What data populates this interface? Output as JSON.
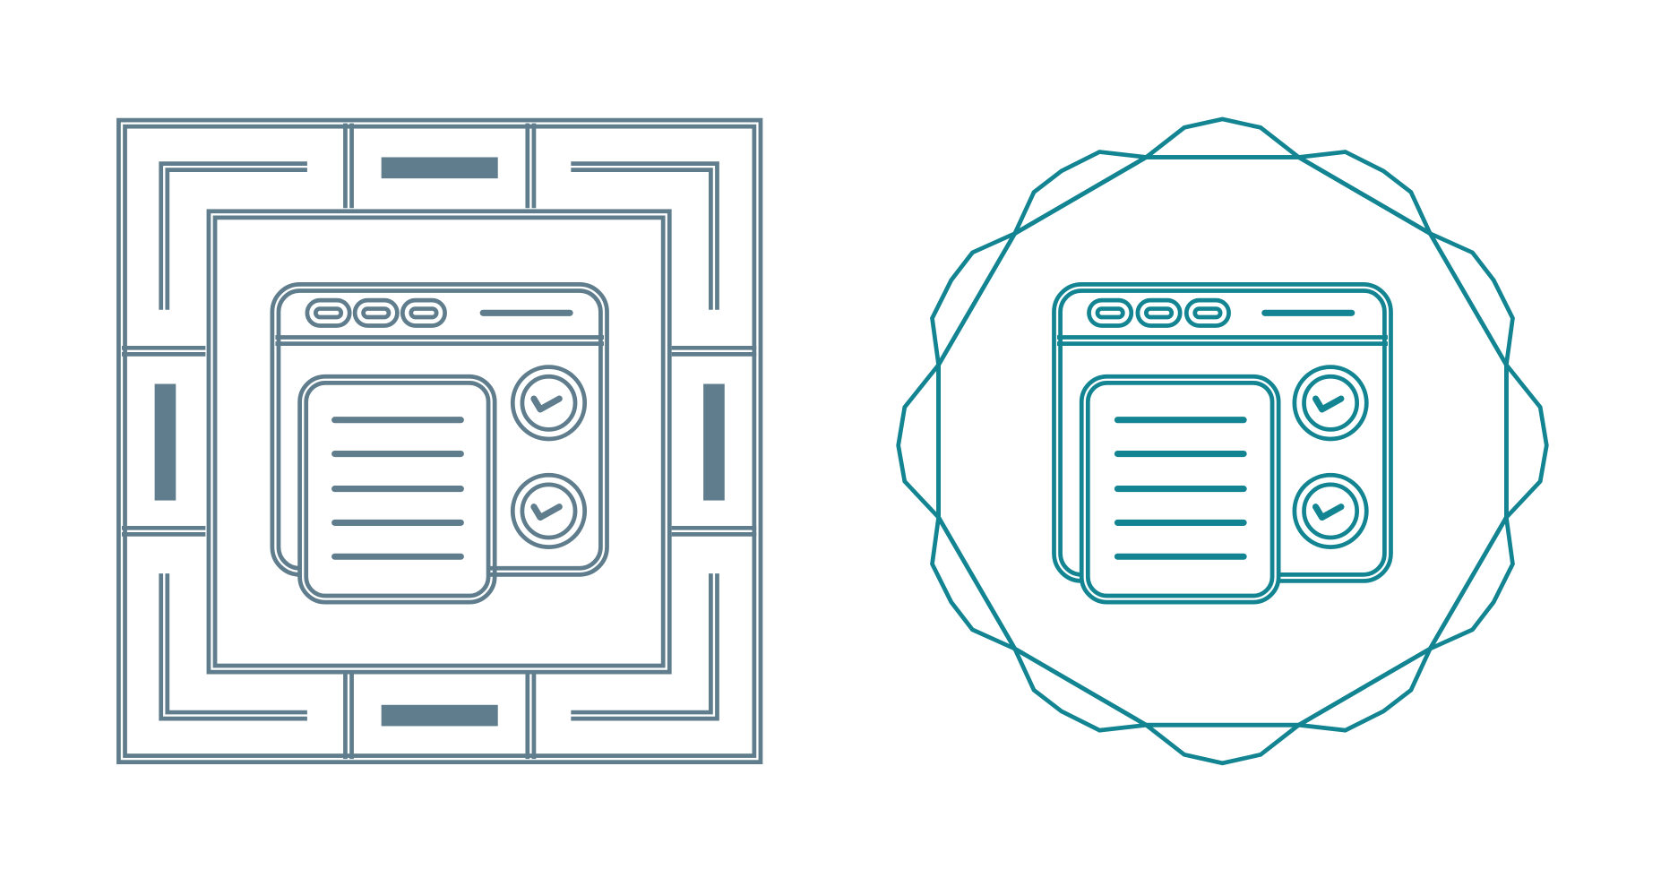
{
  "icons": [
    {
      "id": "left",
      "name": "browser-checklist-icon-square-frame",
      "frame": "square-maze",
      "color": "#5F7D8C"
    },
    {
      "id": "right",
      "name": "browser-checklist-icon-badge-frame",
      "frame": "octagon-badge",
      "color": "#138491"
    }
  ]
}
